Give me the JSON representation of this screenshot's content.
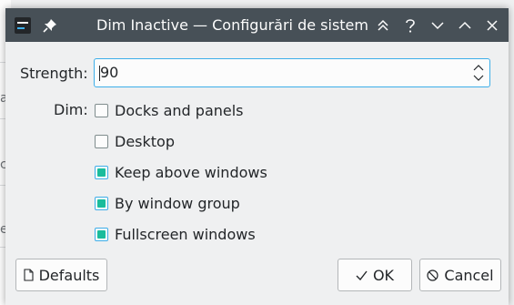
{
  "window": {
    "title": "Dim Inactive — Configurări de sistem",
    "app_icon": "settings-sliders-icon",
    "pin_icon": "pin-icon",
    "buttons": [
      "keep-above-icon",
      "help-icon",
      "minimize-icon",
      "maximize-icon",
      "close-icon"
    ]
  },
  "background": {
    "fragments": [
      "a",
      "c",
      "e"
    ]
  },
  "form": {
    "strength_label": "Strength:",
    "strength_value": "90",
    "dim_label": "Dim:",
    "options": [
      {
        "label": "Docks and panels",
        "checked": false
      },
      {
        "label": "Desktop",
        "checked": false
      },
      {
        "label": "Keep above windows",
        "checked": true
      },
      {
        "label": "By window group",
        "checked": true
      },
      {
        "label": "Fullscreen windows",
        "checked": true
      }
    ]
  },
  "footer": {
    "defaults_label": "Defaults",
    "ok_label": "OK",
    "cancel_label": "Cancel"
  },
  "colors": {
    "titlebar": "#475057",
    "accent": "#3daee9",
    "check_fill": "#1abc9c"
  }
}
